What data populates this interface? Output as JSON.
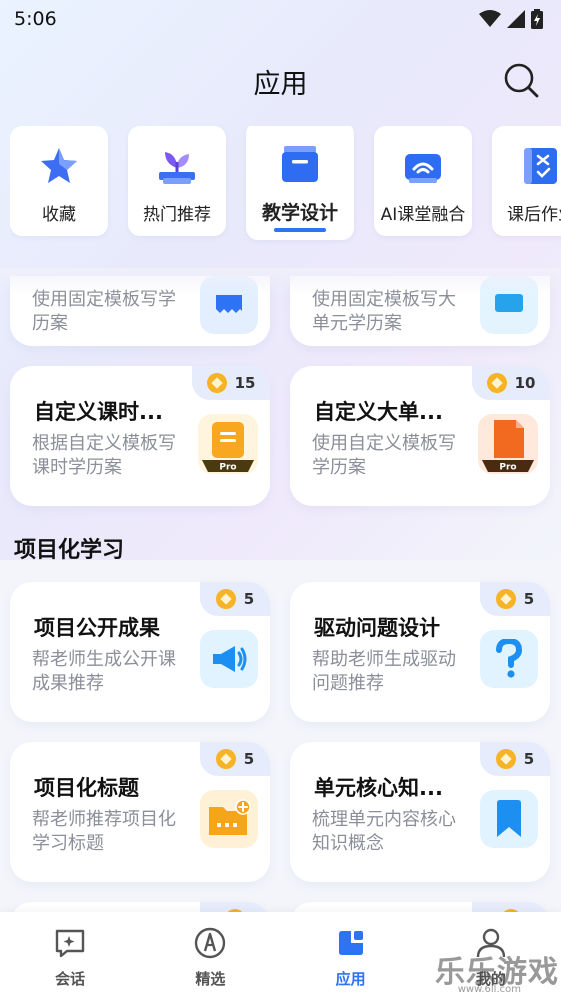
{
  "status": {
    "time": "5:06"
  },
  "header": {
    "title": "应用"
  },
  "categories": [
    {
      "label": "收藏",
      "icon": "star-icon"
    },
    {
      "label": "热门推荐",
      "icon": "sprout-icon"
    },
    {
      "label": "教学设计",
      "icon": "cabinet-icon",
      "active": true
    },
    {
      "label": "AI课堂融合",
      "icon": "classroom-icon"
    },
    {
      "label": "课后作业",
      "icon": "homework-icon"
    }
  ],
  "partial_cards": [
    {
      "desc": "使用固定模板写学历案"
    },
    {
      "desc": "使用固定模板写大单元学历案"
    }
  ],
  "custom_cards": [
    {
      "title": "自定义课时...",
      "desc": "根据自定义模板写课时学历案",
      "cost": "15",
      "icon_tag": "Pro",
      "color": "#f7b02a"
    },
    {
      "title": "自定义大单...",
      "desc": "使用自定义模板写学历案",
      "cost": "10",
      "icon_tag": "Pro",
      "color": "#f26f28"
    }
  ],
  "section": {
    "title": "项目化学习"
  },
  "project_cards": [
    {
      "title": "项目公开成果",
      "desc": "帮老师生成公开课成果推荐",
      "cost": "5",
      "icon": "megaphone-icon"
    },
    {
      "title": "驱动问题设计",
      "desc": "帮助老师生成驱动问题推荐",
      "cost": "5",
      "icon": "question-icon"
    },
    {
      "title": "项目化标题",
      "desc": "帮老师推荐项目化学习标题",
      "cost": "5",
      "icon": "folder-add-icon"
    },
    {
      "title": "单元核心知...",
      "desc": "梳理单元内容核心知识概念",
      "cost": "5",
      "icon": "bookmark-icon"
    }
  ],
  "nav": [
    {
      "label": "会话",
      "icon": "chat-icon"
    },
    {
      "label": "精选",
      "icon": "compass-icon"
    },
    {
      "label": "应用",
      "icon": "apps-icon",
      "active": true
    },
    {
      "label": "我的",
      "icon": "user-icon"
    }
  ],
  "watermark": {
    "text": "乐乐游戏",
    "sub": "www.6ll.com"
  }
}
